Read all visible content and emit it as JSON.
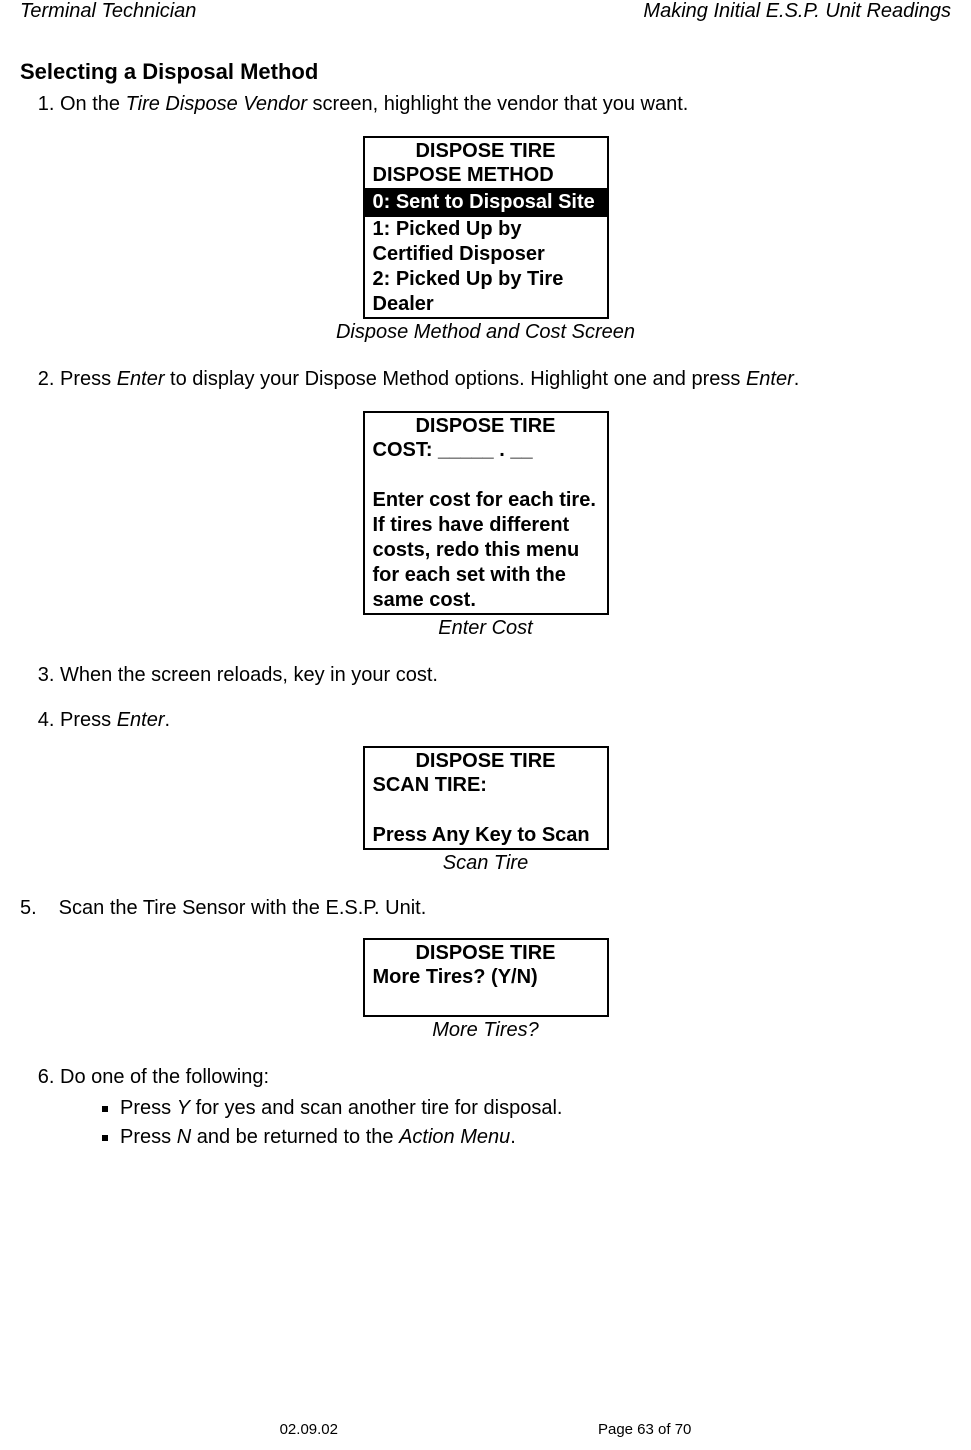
{
  "header": {
    "left": "Terminal Technician",
    "right": "Making Initial E.S.P. Unit Readings"
  },
  "section": {
    "title": "Selecting a Disposal Method"
  },
  "steps": {
    "s1_pre": "On the ",
    "s1_em": "Tire Dispose Vendor",
    "s1_post": " screen, highlight the vendor that you want.",
    "s2_pre": "Press ",
    "s2_em": "Enter",
    "s2_post": " to display your Dispose Method options.  Highlight one and press ",
    "s2_em2": "Enter",
    "s2_end": ".",
    "s3": "When the screen reloads, key in your cost.",
    "s4_pre": "Press ",
    "s4_em": "Enter",
    "s4_post": ".",
    "s5": "Scan the Tire Sensor with the E.S.P. Unit.",
    "s6": "Do one of the following:",
    "b1_pre": "Press ",
    "b1_em": "Y",
    "b1_post": " for yes and scan another tire for disposal.",
    "b2_pre": "Press ",
    "b2_em": "N",
    "b2_mid": " and be returned to the ",
    "b2_em2": "Action Menu",
    "b2_post": "."
  },
  "box1": {
    "title": "DISPOSE TIRE",
    "subtitle": "DISPOSE METHOD",
    "opt0": "0: Sent to Disposal Site",
    "opt1": "1: Picked Up by Certified Disposer",
    "opt2": "2: Picked Up by Tire Dealer",
    "caption": "Dispose Method and Cost Screen"
  },
  "box2": {
    "title": "DISPOSE TIRE",
    "cost": "COST: _____ . __",
    "l1": "Enter cost for each tire.",
    "l2": "If tires have different costs, redo this menu",
    "l3": "for each set with the same cost.",
    "caption": "Enter Cost"
  },
  "box3": {
    "title": "DISPOSE TIRE",
    "l1": "SCAN TIRE:",
    "l2": "Press Any Key to Scan",
    "caption": "Scan Tire"
  },
  "box4": {
    "title": "DISPOSE TIRE",
    "l1": "More Tires?  (Y/N)",
    "caption": "More Tires?"
  },
  "footer": {
    "date": "02.09.02",
    "page": "Page 63 of 70"
  }
}
